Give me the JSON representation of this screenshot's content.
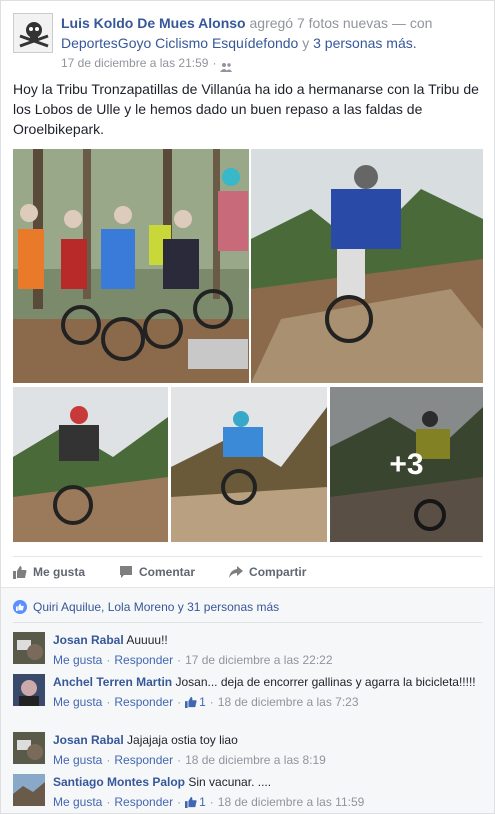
{
  "post": {
    "author": "Luis Koldo De Mues Alonso",
    "action_text": "agregó 7 fotos nuevas — con",
    "tagged_page": "DeportesGoyo Ciclismo Esquídefondo",
    "and_text": "y",
    "others": "3 personas más.",
    "timestamp": "17 de diciembre a las 21:59",
    "separator": "·",
    "privacy_icon": "people-icon",
    "message": "Hoy la Tribu Tronzapatillas de Villanúa ha ido a hermanarse con la Tribu de los Lobos de Ulle y le hemos dado un buen repaso a las faldas de Oroelbikepark.",
    "more_photos": "+3"
  },
  "actions": {
    "like": "Me gusta",
    "comment": "Comentar",
    "share": "Compartir"
  },
  "likes_summary": "Quiri Aquilue, Lola Moreno y 31 personas más",
  "comments": [
    {
      "name": "Josan Rabal",
      "text": "Auuuu!!",
      "like": "Me gusta",
      "reply": "Responder",
      "likes": "",
      "time": "17 de diciembre a las 22:22"
    },
    {
      "name": "Anchel Terren Martin",
      "text": "Josan... deja de encorrer gallinas y agarra la bicicleta!!!!!",
      "like": "Me gusta",
      "reply": "Responder",
      "likes": "1",
      "time": "18 de diciembre a las 7:23"
    },
    {
      "name": "Josan Rabal",
      "text": "Jajajaja ostia toy liao",
      "like": "Me gusta",
      "reply": "Responder",
      "likes": "",
      "time": "18 de diciembre a las 8:19"
    },
    {
      "name": "Santiago Montes Palop",
      "text": "Sin vacunar. ....",
      "like": "Me gusta",
      "reply": "Responder",
      "likes": "1",
      "time": "18 de diciembre a las 11:59"
    }
  ],
  "colors": {
    "link": "#365899",
    "meta": "#90949c",
    "like_badge": "#5890ff"
  }
}
